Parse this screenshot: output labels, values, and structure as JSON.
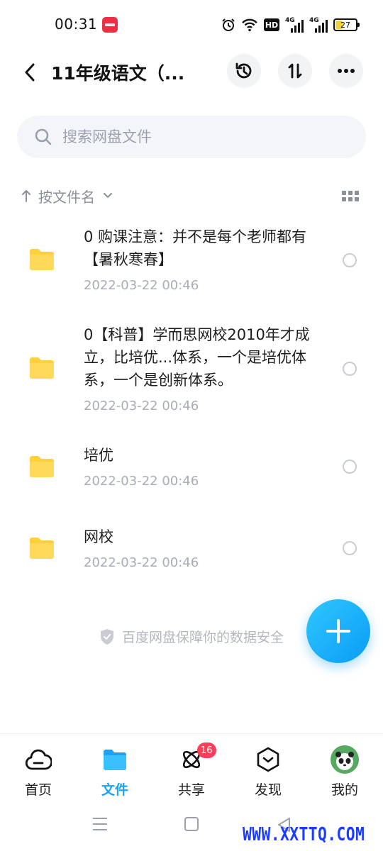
{
  "status_bar": {
    "time": "00:31",
    "hd_label": "HD",
    "signal_1_label": "4G",
    "signal_2_label": "4G",
    "battery": "27"
  },
  "header": {
    "title": "11年级语文（..."
  },
  "search": {
    "placeholder": "搜索网盘文件"
  },
  "sort": {
    "label": "按文件名"
  },
  "files": [
    {
      "name": "0 购课注意：并不是每个老师都有【暑秋寒春】",
      "date": "2022-03-22  00:46"
    },
    {
      "name": "0【科普】学而思网校2010年才成立，比培优...体系，一个是培优体系，一个是创新体系。",
      "date": "2022-03-22  00:46"
    },
    {
      "name": "培优",
      "date": "2022-03-22  00:46"
    },
    {
      "name": "网校",
      "date": "2022-03-22  00:46"
    }
  ],
  "safety_note": "百度网盘保障你的数据安全",
  "bottom_nav": {
    "items": [
      {
        "label": "首页",
        "icon": "cloud-icon"
      },
      {
        "label": "文件",
        "icon": "folder-icon"
      },
      {
        "label": "共享",
        "icon": "atom-icon",
        "badge": "16"
      },
      {
        "label": "发现",
        "icon": "discover-icon"
      },
      {
        "label": "我的",
        "icon": "avatar-icon"
      }
    ],
    "active_index": 1
  },
  "watermark": "WWW.XXTTQ.COM",
  "colors": {
    "accent": "#1aa2f5",
    "folder": "#ffcf3c",
    "badge": "#fa3e5a"
  }
}
